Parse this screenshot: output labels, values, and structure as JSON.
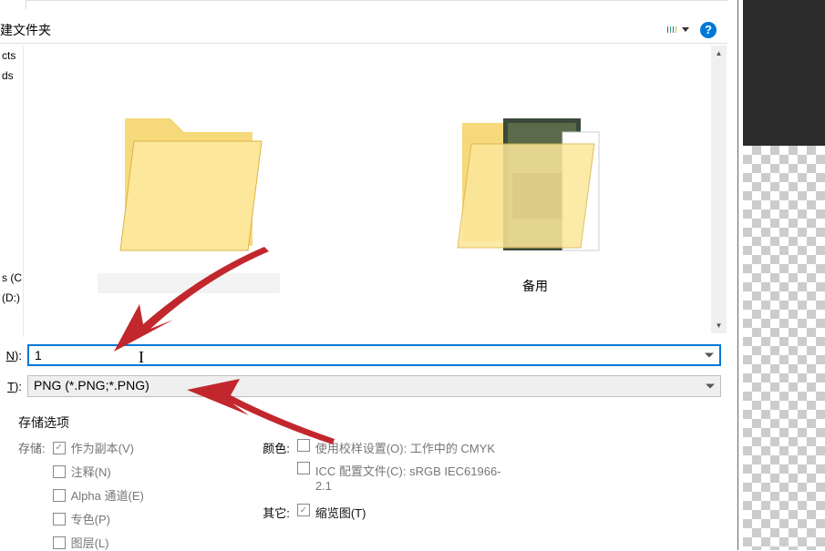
{
  "toolbar": {
    "new_folder_label": "建文件夹"
  },
  "left_panel": {
    "items": [
      "cts",
      "ds",
      "",
      "",
      "",
      "",
      "",
      "",
      "",
      "s (C:)",
      "(D:)"
    ]
  },
  "content": {
    "folders": [
      {
        "label": ""
      },
      {
        "label": "备用"
      }
    ]
  },
  "filename": {
    "label_suffix": "N):",
    "label_underline": "N",
    "value": "1"
  },
  "filetype": {
    "label_suffix": "T):",
    "label_underline": "T",
    "value": "PNG (*.PNG;*.PNG)"
  },
  "options": {
    "title": "存储选项",
    "save_label": "存储:",
    "checks": {
      "as_copy": "作为副本(V)",
      "notes": "注释(N)",
      "alpha": "Alpha 通道(E)",
      "spot": "专色(P)",
      "layers": "图层(L)"
    },
    "color_label": "颜色:",
    "proof_setup": "使用校样设置(O): 工作中的 CMYK",
    "icc_profile": "ICC 配置文件(C): sRGB IEC61966-2.1",
    "other_label": "其它:",
    "thumbnail": "缩览图(T)"
  }
}
